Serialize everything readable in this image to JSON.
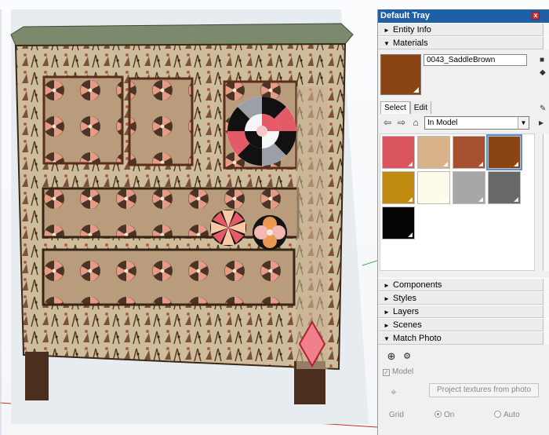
{
  "tray": {
    "title": "Default Tray",
    "close_glyph": "x"
  },
  "panels": {
    "entity_info": "Entity Info",
    "materials": "Materials",
    "components": "Components",
    "styles": "Styles",
    "layers": "Layers",
    "scenes": "Scenes",
    "match_photo": "Match Photo"
  },
  "materials": {
    "current_name": "0043_SaddleBrown",
    "current_color": "#8b4513",
    "tabs": [
      "Select",
      "Edit"
    ],
    "collection": "In Model",
    "swatches": [
      {
        "name": "swatch-salmon",
        "color": "#d9545c"
      },
      {
        "name": "swatch-tan",
        "color": "#d8b38a"
      },
      {
        "name": "swatch-sienna",
        "color": "#a65030"
      },
      {
        "name": "swatch-saddlebrown",
        "color": "#8b4513"
      },
      {
        "name": "swatch-goldenrod",
        "color": "#c08a10"
      },
      {
        "name": "swatch-ivory",
        "color": "#fdfbe9"
      },
      {
        "name": "swatch-gray",
        "color": "#a7a7a7"
      },
      {
        "name": "swatch-dimgray",
        "color": "#686868"
      },
      {
        "name": "swatch-black",
        "color": "#050505"
      }
    ]
  },
  "match_photo": {
    "model_label": "Model",
    "project_button": "Project textures from photo",
    "grid_label": "Grid",
    "on_label": "On",
    "auto_label": "Auto"
  },
  "icons": {
    "back": "⇦",
    "forward": "⇨",
    "home": "⌂",
    "add": "⊕",
    "settings": "⚙",
    "target": "⌖",
    "arrow_down": "▼",
    "arrow_right": "►"
  }
}
